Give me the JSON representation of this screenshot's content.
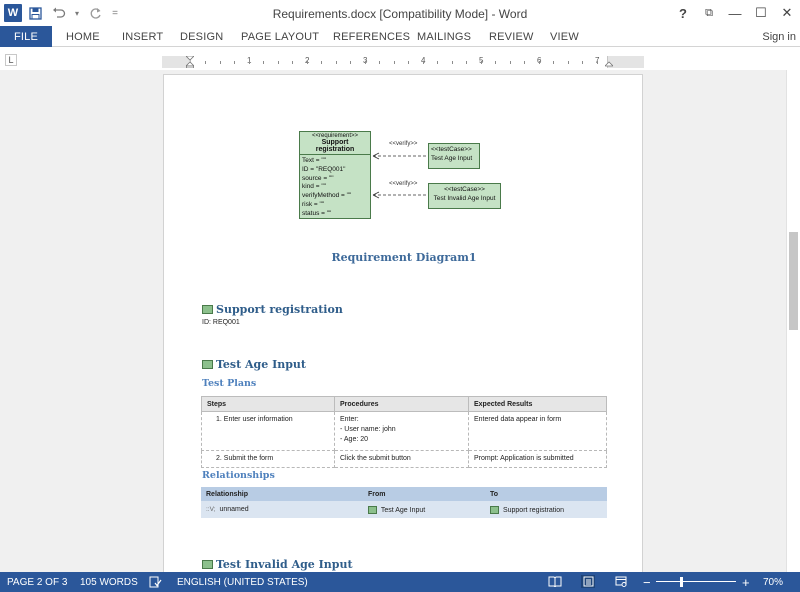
{
  "window": {
    "title": "Requirements.docx [Compatibility Mode] - Word",
    "controls": {
      "help": "?",
      "ribbon_display": "⧉",
      "minimize": "—",
      "restore": "☐",
      "close": "✕"
    }
  },
  "qat": {
    "logo": "W",
    "save_icon": "save-icon",
    "undo_icon": "undo-icon",
    "redo_icon": "redo-icon",
    "customize": "="
  },
  "ribbon": {
    "tabs": [
      "FILE",
      "HOME",
      "INSERT",
      "DESIGN",
      "PAGE LAYOUT",
      "REFERENCES",
      "MAILINGS",
      "REVIEW",
      "VIEW"
    ],
    "signin": "Sign in"
  },
  "ruler": {
    "tab_selector": "L",
    "numbers": [
      "1",
      "2",
      "3",
      "4",
      "5",
      "6",
      "7"
    ]
  },
  "diagram": {
    "requirement": {
      "stereotype": "<<requirement>>",
      "name": "Support registration",
      "attributes": [
        "Text = \"\"",
        "ID = \"REQ001\"",
        "source = \"\"",
        "kind = \"\"",
        "verifyMethod = \"\"",
        "risk = \"\"",
        "status = \"\""
      ]
    },
    "test_case_1": {
      "stereotype": "<<testCase>>",
      "name": "Test Age Input"
    },
    "test_case_2": {
      "stereotype": "<<testCase>>",
      "name": "Test Invalid Age Input"
    },
    "verify_label_1": "<<verify>>",
    "verify_label_2": "<<verify>>",
    "caption": "Requirement Diagram1"
  },
  "doc": {
    "support_heading": "Support registration",
    "support_id": "ID: REQ001",
    "test_age_heading": "Test Age Input",
    "test_plans_heading": "Test Plans",
    "test_plans": {
      "headers": [
        "Steps",
        "Procedures",
        "Expected Results"
      ],
      "rows": [
        {
          "step": "1. Enter user information",
          "proc": [
            "Enter:",
            "- User name: john",
            "- Age: 20"
          ],
          "result": "Entered data appear in form"
        },
        {
          "step": "2. Submit the form",
          "proc": [
            "Click the submit button"
          ],
          "result": "Prompt: Application is submitted"
        }
      ]
    },
    "relationships_heading": "Relationships",
    "relationships": {
      "headers": [
        "Relationship",
        "From",
        "To"
      ],
      "rows": [
        {
          "relationship": "unnamed",
          "relationship_glyph": "::V;",
          "from": "Test Age Input",
          "to": "Support registration"
        }
      ]
    },
    "test_invalid_heading": "Test Invalid Age Input"
  },
  "status": {
    "page": "PAGE 2 OF 3",
    "words": "105 WORDS",
    "language": "ENGLISH (UNITED STATES)",
    "zoom_minus": "−",
    "zoom_plus": "+",
    "zoom": "70%",
    "zoom_level_percent": 70
  },
  "colors": {
    "accent": "#2b579a",
    "heading": "#2f5d8a",
    "element_fill": "#c5e2c5",
    "rel_header": "#b8cce4",
    "rel_row": "#dbe5f1"
  }
}
